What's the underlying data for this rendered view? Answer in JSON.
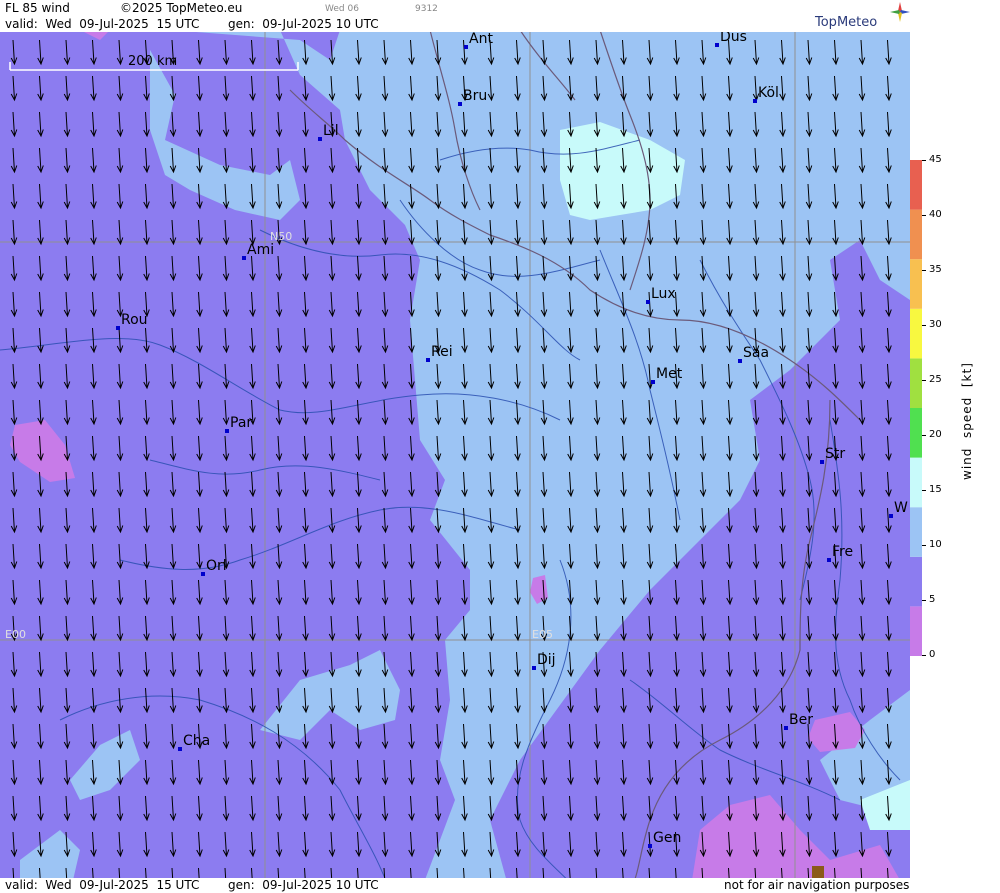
{
  "header": {
    "product": "FL 85 wind",
    "copyright": "©2025 TopMeteo.eu",
    "day_tab": "Wed 06",
    "code": "9312",
    "valid": "valid:  Wed  09-Jul-2025  15 UTC",
    "generated": "gen:  09-Jul-2025 10 UTC",
    "brand": "TopMeteo"
  },
  "footer": {
    "valid": "valid:  Wed  09-Jul-2025  15 UTC",
    "generated": "gen:  09-Jul-2025 10 UTC",
    "disclaimer": "not for air navigation purposes"
  },
  "scale_bar": {
    "label": "200 km"
  },
  "grid_labels": {
    "lat": "N50",
    "lon0": "E00",
    "lon5": "E05"
  },
  "cities": [
    {
      "id": "ant",
      "name": "Ant"
    },
    {
      "id": "dus",
      "name": "Düs"
    },
    {
      "id": "bru",
      "name": "Bru"
    },
    {
      "id": "kol",
      "name": "Köl"
    },
    {
      "id": "lil",
      "name": "Lil"
    },
    {
      "id": "ami",
      "name": "Ami"
    },
    {
      "id": "lux",
      "name": "Lux"
    },
    {
      "id": "rou",
      "name": "Rou"
    },
    {
      "id": "rei",
      "name": "Rei"
    },
    {
      "id": "saa",
      "name": "Saa"
    },
    {
      "id": "met",
      "name": "Met"
    },
    {
      "id": "par",
      "name": "Par"
    },
    {
      "id": "str",
      "name": "Str"
    },
    {
      "id": "w",
      "name": "W"
    },
    {
      "id": "fre",
      "name": "Fre"
    },
    {
      "id": "orl",
      "name": "Orl"
    },
    {
      "id": "dij",
      "name": "Dij"
    },
    {
      "id": "ber",
      "name": "Ber"
    },
    {
      "id": "cha",
      "name": "Cha"
    },
    {
      "id": "gen",
      "name": "Gen"
    }
  ],
  "legend": {
    "title": "wind  speed  [kt]",
    "unit": "kt",
    "ticks": [
      "45",
      "40",
      "35",
      "30",
      "25",
      "20",
      "15",
      "10",
      "5",
      "0"
    ],
    "bands": [
      {
        "from": 0,
        "to": 5,
        "color": "#c77be8"
      },
      {
        "from": 5,
        "to": 10,
        "color": "#8c7cf0"
      },
      {
        "from": 10,
        "to": 15,
        "color": "#9cc4f4"
      },
      {
        "from": 15,
        "to": 20,
        "color": "#c8fafa"
      },
      {
        "from": 20,
        "to": 25,
        "color": "#50e050"
      },
      {
        "from": 25,
        "to": 30,
        "color": "#a0e040"
      },
      {
        "from": 30,
        "to": 35,
        "color": "#f8f840"
      },
      {
        "from": 35,
        "to": 40,
        "color": "#f8c050"
      },
      {
        "from": 40,
        "to": 45,
        "color": "#f09050"
      },
      {
        "from": 45,
        "to": 50,
        "color": "#e86050"
      }
    ]
  },
  "colors": {
    "purple_5_10": "#8c7cf0",
    "blue_10_15": "#9cc4f4",
    "cyan_15_20": "#c8fafa",
    "violet_0_5": "#c77be8",
    "city_marker": "#0000cc",
    "river": "#2a4fb0",
    "border": "#6b5a7a",
    "grid": "#909090"
  },
  "wind": {
    "direction": "from north, all arrows pointing south"
  }
}
